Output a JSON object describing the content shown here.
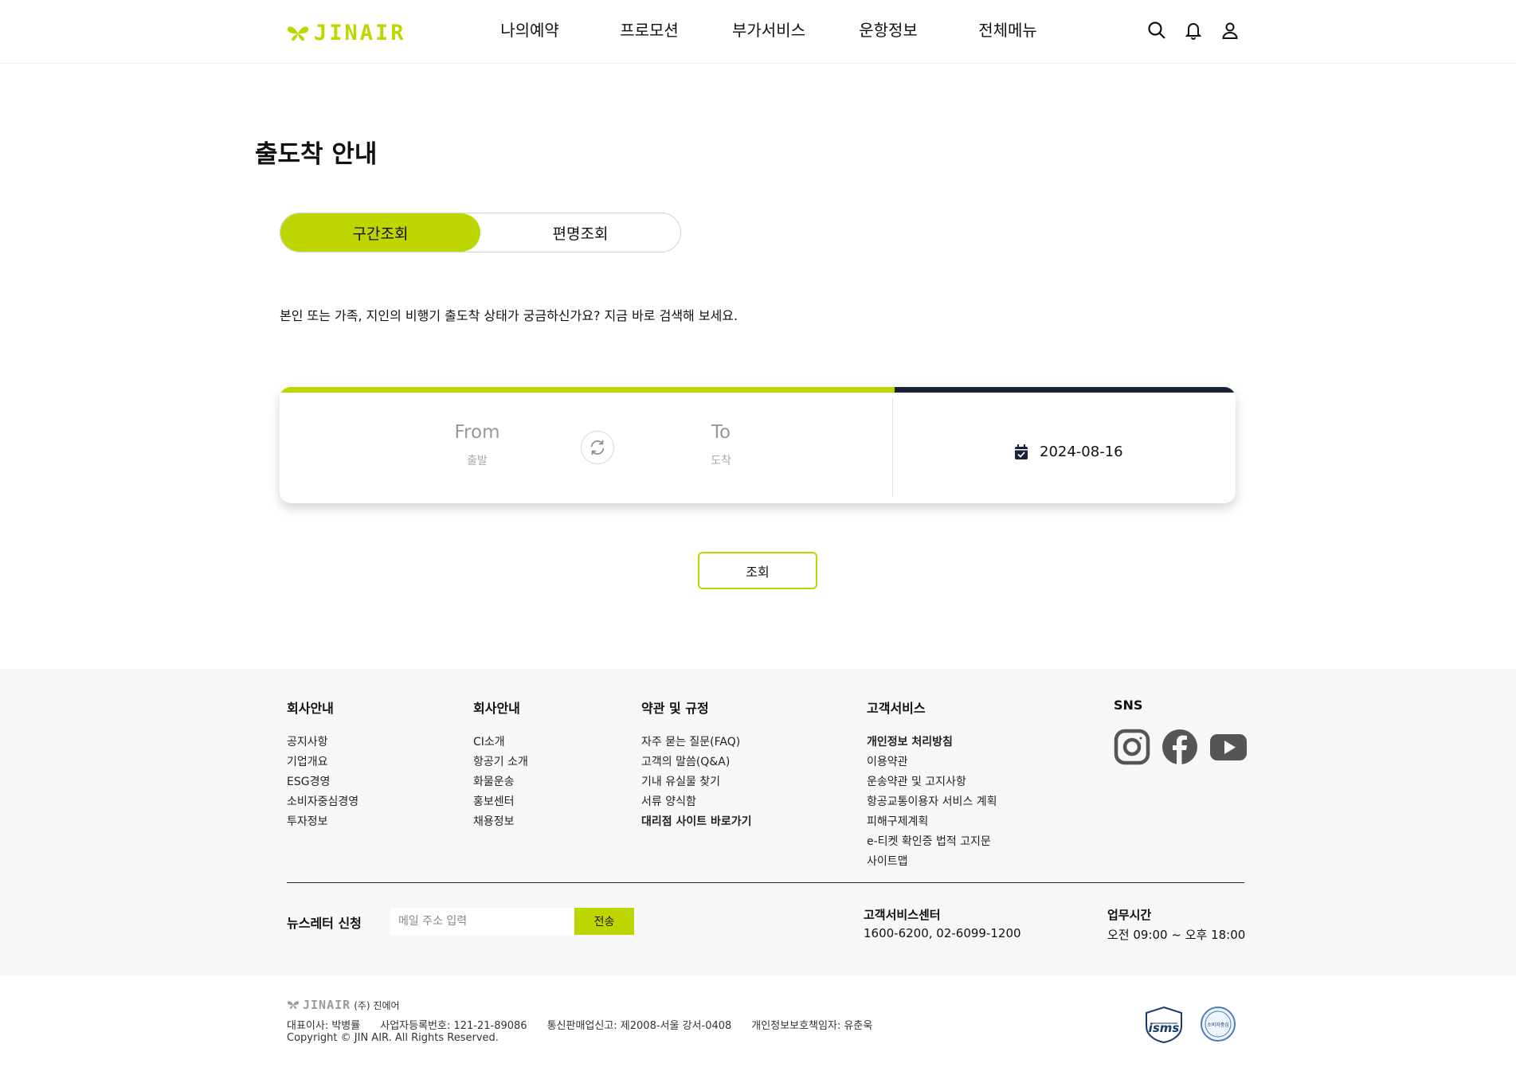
{
  "header": {
    "logo": "JINAIR",
    "nav": [
      "나의예약",
      "프로모션",
      "부가서비스",
      "운항정보",
      "전체메뉴"
    ]
  },
  "main": {
    "title": "출도착 안내",
    "tabs": [
      {
        "label": "구간조회",
        "active": true
      },
      {
        "label": "편명조회",
        "active": false
      }
    ],
    "description": "본인 또는 가족, 지인의 비행기 출도착 상태가 궁금하신가요? 지금 바로 검색해 보세요.",
    "search": {
      "from_code": "From",
      "from_label": "출발",
      "to_code": "To",
      "to_label": "도착",
      "date": "2024-08-16"
    },
    "search_button": "조회"
  },
  "footer": {
    "col1": {
      "title": "회사안내",
      "items": [
        "공지사항",
        "기업개요",
        "ESG경영",
        "소비자중심경영",
        "투자정보"
      ]
    },
    "col2": {
      "title": "회사안내",
      "items": [
        "CI소개",
        "항공기 소개",
        "화물운송",
        "홍보센터",
        "채용정보"
      ]
    },
    "col3": {
      "title": "약관 및 규정",
      "items": [
        "자주 묻는 질문(FAQ)",
        "고객의 말씀(Q&A)",
        "기내 유실물 찾기",
        "서류 양식함",
        "대리점 사이트 바로가기"
      ]
    },
    "col4": {
      "title": "고객서비스",
      "items": [
        "개인정보 처리방침",
        "이용약관",
        "운송약관 및 고지사항",
        "항공교통이용자 서비스 계획",
        "피해구제계획",
        "e-티켓 확인증 법적 고지문",
        "사이트맵"
      ]
    },
    "sns": {
      "title": "SNS"
    },
    "newsletter": {
      "title": "뉴스레터 신청",
      "placeholder": "메일 주소 입력",
      "button": "전송"
    },
    "customer_center": {
      "title": "고객서비스센터",
      "value": "1600-6200, 02-6099-1200"
    },
    "business_hours": {
      "title": "업무시간",
      "value": "오전 09:00 ~ 오후 18:00"
    }
  },
  "bottom": {
    "logo": "JINAIR",
    "company": "(주) 진에어",
    "ceo": "대표이사: 박병률",
    "biz_no": "사업자등록번호: 121-21-89086",
    "mail_order": "통신판매업신고: 제2008-서울 강서-0408",
    "privacy_officer": "개인정보보호책임자: 유춘욱",
    "copyright": "Copyright © JIN AIR. All Rights Reserved.",
    "badge_isms": "isms",
    "badge_cc": "소비자중심"
  },
  "colors": {
    "accent": "#bed600",
    "navy": "#1b2138"
  }
}
